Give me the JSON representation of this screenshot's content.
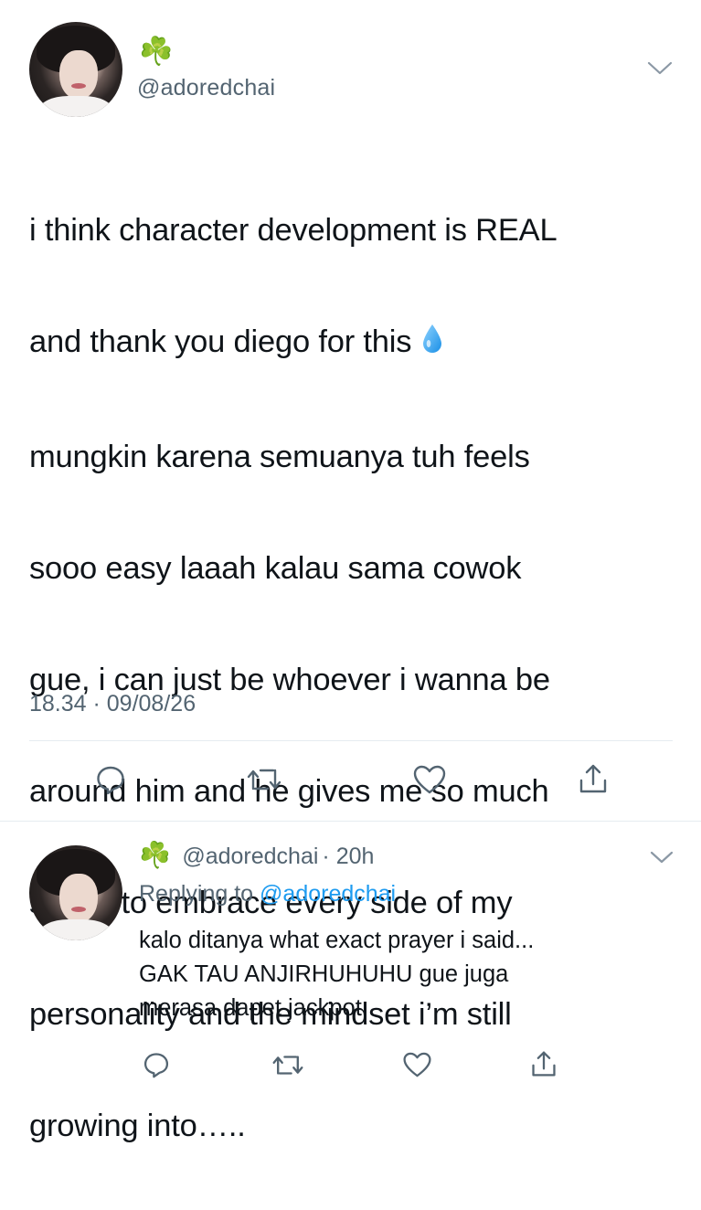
{
  "tweet": {
    "display_name_emoji": "☘️",
    "handle": "@adoredchai",
    "avatar_icon": "profile-photo",
    "text_lines": [
      "i think character development is REAL",
      "and thank you diego for this",
      "mungkin karena semuanya tuh feels",
      "sooo easy laaah kalau sama cowok",
      "gue, i can just be whoever i wanna be",
      "around him and he gives me so much",
      "space to embrace every side of my",
      "personality and the mindset i’m still",
      "growing into….."
    ],
    "inline_emoji": "droplet-icon",
    "timestamp": "18.34 · 09/08/26",
    "actions": [
      "reply-icon",
      "retweet-icon",
      "like-icon",
      "share-icon"
    ]
  },
  "reply": {
    "display_name_emoji": "☘️",
    "handle": "@adoredchai",
    "time_ago": "· 20h",
    "replying_label": "Replying to",
    "replying_handle": "@adoredchai",
    "text_lines": [
      "kalo ditanya what exact prayer i said...",
      "GAK TAU ANJIRHUHUHU gue juga",
      "merasa dapet jackpot"
    ],
    "actions": [
      "reply-icon",
      "retweet-icon",
      "like-icon",
      "share-icon"
    ]
  },
  "colors": {
    "text": "#0f1419",
    "secondary": "#536471",
    "link": "#1d9bf0",
    "divider": "#e6ecf0",
    "clover": "#2f9e3a"
  }
}
